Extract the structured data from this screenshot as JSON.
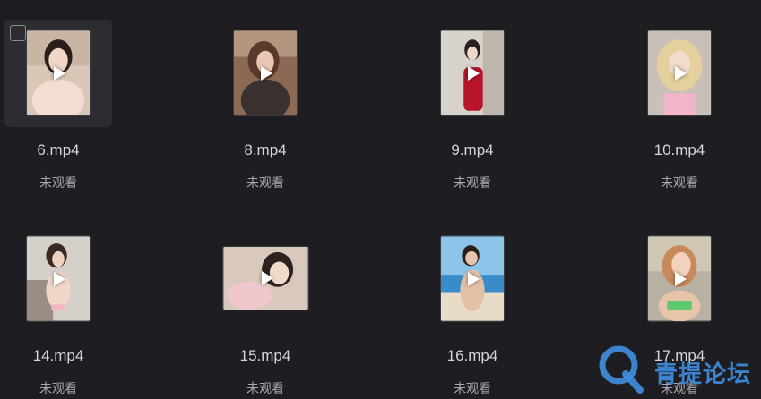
{
  "files": [
    {
      "name": "6.mp4",
      "status": "未观看"
    },
    {
      "name": "8.mp4",
      "status": "未观看"
    },
    {
      "name": "9.mp4",
      "status": "未观看"
    },
    {
      "name": "10.mp4",
      "status": "未观看"
    },
    {
      "name": "14.mp4",
      "status": "未观看"
    },
    {
      "name": "15.mp4",
      "status": "未观看"
    },
    {
      "name": "16.mp4",
      "status": "未观看"
    },
    {
      "name": "17.mp4",
      "status": "未观看"
    }
  ],
  "watermark": {
    "text": "青提论坛",
    "color": "#3f8fe0"
  },
  "colors": {
    "background": "#1e1e22",
    "hover": "#2c2c31",
    "filename": "#d6d6da",
    "status": "#a8a8ae"
  },
  "icons": {
    "play": "play-icon",
    "checkbox": "checkbox-icon",
    "watermark_logo": "q-logo-icon"
  }
}
